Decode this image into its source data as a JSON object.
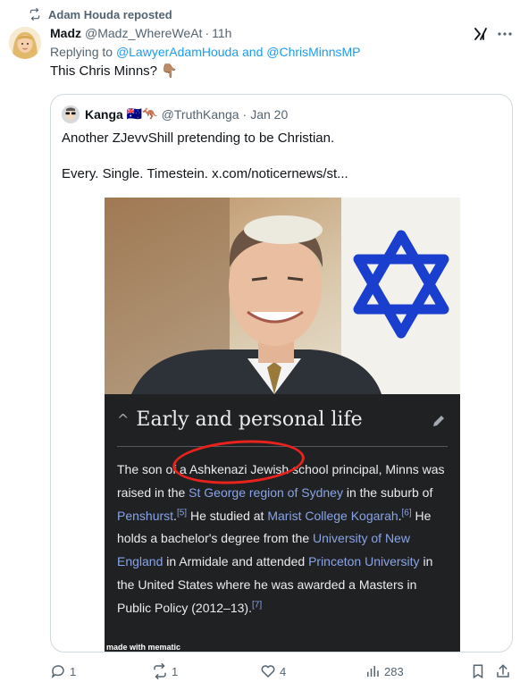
{
  "repost": {
    "label": "Adam Houda reposted",
    "icon": "repost-icon"
  },
  "tweet": {
    "name": "Madz",
    "handle": "@Madz_WhereWeAt",
    "dot": "·",
    "time": "11h",
    "reply_prefix": "Replying to ",
    "reply_user1": "@LawyerAdamHouda",
    "reply_and": " and ",
    "reply_user2": "@ChrisMinnsMP",
    "text": "This Chris Minns?",
    "emoji": "👇🏽"
  },
  "quote": {
    "name": "Kanga",
    "flags": "🇦🇺🦘",
    "handle": "@TruthKanga",
    "dot": "·",
    "time": "Jan 20",
    "text1": "Another ZJevvShill  pretending to be Christian.",
    "text2": "Every. Single. Timestein.  x.com/noticernews/st...",
    "media": {
      "wiki_heading": "Early and personal life",
      "p1": "The son of a Ashkenazi Jewish school principal, Minns was raised in the ",
      "l1": "St George region of Sydney",
      "p2": " in the suburb of ",
      "l2": "Penshurst",
      "r1": "[5]",
      "p3": " He studied at ",
      "l3": "Marist College Kogarah",
      "r2": "[6]",
      "p4": " He holds a bachelor's degree from the ",
      "l4": "University of New England",
      "p5": " in Armidale and attended ",
      "l5": "Princeton University",
      "p6": " in the United States where he was awarded a Masters in Public Policy (2012–13).",
      "r3": "[7]",
      "watermark": "made with mematic"
    }
  },
  "actions": {
    "replies": "1",
    "reposts": "1",
    "likes": "4",
    "views": "283"
  },
  "colors": {
    "link": "#1d9bf0",
    "muted": "#536471",
    "star": "#1a3fcf",
    "circle": "#e8231d"
  }
}
